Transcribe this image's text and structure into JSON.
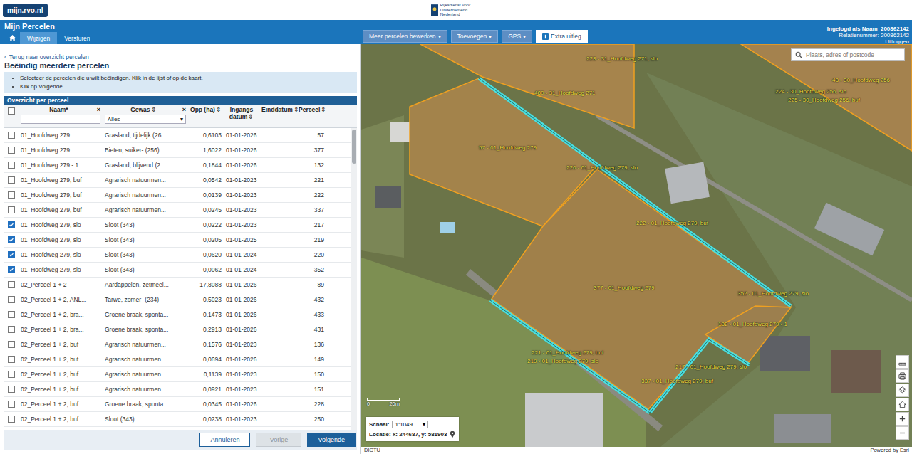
{
  "header": {
    "site_badge": "mijn.rvo.nl",
    "org": "Rijksdienst voor Ondernemend Nederland",
    "app_title": "Mijn Percelen",
    "user": "Ingelogd als Naam_200862142",
    "relation": "Relatienummer: 200862142",
    "logout": "Uitloggen"
  },
  "tabs": [
    {
      "label": "Wijzigen",
      "selected": true
    },
    {
      "label": "Versturen",
      "selected": false
    }
  ],
  "toolbar": [
    {
      "label": "Meer percelen bewerken",
      "caret": "▾",
      "primary": false
    },
    {
      "label": "Toevoegen",
      "caret": "▾",
      "primary": false
    },
    {
      "label": "GPS",
      "caret": "▾",
      "primary": false
    },
    {
      "label": "Extra uitleg",
      "caret": "",
      "primary": true
    }
  ],
  "panel": {
    "back_icon": "‹",
    "back": "Terug naar overzicht percelen",
    "title": "Beëindig meerdere percelen",
    "instructions": [
      "Selecteer de percelen die u wilt beëindigen. Klik in de lijst of op de kaart.",
      "Klik op Volgende."
    ],
    "table_title": "Overzicht per perceel"
  },
  "table": {
    "all_checked": false,
    "name_filter": "",
    "crop_filter": "Alles",
    "crop_filter_caret": "▾",
    "columns": [
      {
        "label": "Naam*",
        "sort": "",
        "clear": "×"
      },
      {
        "label": "Gewas",
        "sort": "⇕",
        "clear": "×"
      },
      {
        "label": "Opp (ha)",
        "sort": "⇕",
        "clear": ""
      },
      {
        "label": "Ingangs datum",
        "sort": "⇕",
        "clear": ""
      },
      {
        "label": "Einddatum",
        "sort": "⇕",
        "clear": ""
      },
      {
        "label": "Perceel",
        "sort": "⇕",
        "clear": ""
      }
    ],
    "rows": [
      {
        "checked": false,
        "name": "01_Hoofdweg 279",
        "crop": "Grasland, tijdelijk (26...",
        "area": "0,6103",
        "start": "01-01-2026",
        "end": "",
        "parcel": "57"
      },
      {
        "checked": false,
        "name": "01_Hoofdweg 279",
        "crop": "Bieten, suiker- (256)",
        "area": "1,6022",
        "start": "01-01-2026",
        "end": "",
        "parcel": "377"
      },
      {
        "checked": false,
        "name": "01_Hoofdweg 279 - 1",
        "crop": "Grasland, blijvend (2...",
        "area": "0,1844",
        "start": "01-01-2026",
        "end": "",
        "parcel": "132"
      },
      {
        "checked": false,
        "name": "01_Hoofdweg 279, buf",
        "crop": "Agrarisch natuurmen...",
        "area": "0,0542",
        "start": "01-01-2023",
        "end": "",
        "parcel": "221"
      },
      {
        "checked": false,
        "name": "01_Hoofdweg 279, buf",
        "crop": "Agrarisch natuurmen...",
        "area": "0,0139",
        "start": "01-01-2023",
        "end": "",
        "parcel": "222"
      },
      {
        "checked": false,
        "name": "01_Hoofdweg 279, buf",
        "crop": "Agrarisch natuurmen...",
        "area": "0,0245",
        "start": "01-01-2023",
        "end": "",
        "parcel": "337"
      },
      {
        "checked": true,
        "name": "01_Hoofdweg 279, slo",
        "crop": "Sloot (343)",
        "area": "0,0222",
        "start": "01-01-2023",
        "end": "",
        "parcel": "217"
      },
      {
        "checked": true,
        "name": "01_Hoofdweg 279, slo",
        "crop": "Sloot (343)",
        "area": "0,0205",
        "start": "01-01-2025",
        "end": "",
        "parcel": "219"
      },
      {
        "checked": true,
        "name": "01_Hoofdweg 279, slo",
        "crop": "Sloot (343)",
        "area": "0,0620",
        "start": "01-01-2024",
        "end": "",
        "parcel": "220"
      },
      {
        "checked": true,
        "name": "01_Hoofdweg 279, slo",
        "crop": "Sloot (343)",
        "area": "0,0062",
        "start": "01-01-2024",
        "end": "",
        "parcel": "352"
      },
      {
        "checked": false,
        "name": "02_Perceel 1 + 2",
        "crop": "Aardappelen, zetmeel...",
        "area": "17,8088",
        "start": "01-01-2026",
        "end": "",
        "parcel": "89"
      },
      {
        "checked": false,
        "name": "02_Perceel 1 + 2, ANL...",
        "crop": "Tarwe, zomer- (234)",
        "area": "0,5023",
        "start": "01-01-2026",
        "end": "",
        "parcel": "432"
      },
      {
        "checked": false,
        "name": "02_Perceel 1 + 2, bra...",
        "crop": "Groene braak, sponta...",
        "area": "0,1473",
        "start": "01-01-2026",
        "end": "",
        "parcel": "433"
      },
      {
        "checked": false,
        "name": "02_Perceel 1 + 2, bra...",
        "crop": "Groene braak, sponta...",
        "area": "0,2913",
        "start": "01-01-2026",
        "end": "",
        "parcel": "431"
      },
      {
        "checked": false,
        "name": "02_Perceel 1 + 2, buf",
        "crop": "Agrarisch natuurmen...",
        "area": "0,1576",
        "start": "01-01-2023",
        "end": "",
        "parcel": "136"
      },
      {
        "checked": false,
        "name": "02_Perceel 1 + 2, buf",
        "crop": "Agrarisch natuurmen...",
        "area": "0,0694",
        "start": "01-01-2026",
        "end": "",
        "parcel": "149"
      },
      {
        "checked": false,
        "name": "02_Perceel 1 + 2, buf",
        "crop": "Agrarisch natuurmen...",
        "area": "0,1139",
        "start": "01-01-2023",
        "end": "",
        "parcel": "150"
      },
      {
        "checked": false,
        "name": "02_Perceel 1 + 2, buf",
        "crop": "Agrarisch natuurmen...",
        "area": "0,0921",
        "start": "01-01-2023",
        "end": "",
        "parcel": "151"
      },
      {
        "checked": false,
        "name": "02_Perceel 1 + 2, buf",
        "crop": "Groene braak, sponta...",
        "area": "0,0345",
        "start": "01-01-2026",
        "end": "",
        "parcel": "228"
      },
      {
        "checked": false,
        "name": "02_Perceel 1 + 2, buf",
        "crop": "Sloot (343)",
        "area": "0,0238",
        "start": "01-01-2023",
        "end": "",
        "parcel": "250"
      }
    ]
  },
  "footer_buttons": [
    {
      "label": "Annuleren",
      "kind": "secondary",
      "disabled": false
    },
    {
      "label": "Vorige",
      "kind": "secondary",
      "disabled": true
    },
    {
      "label": "Volgende",
      "kind": "primary",
      "disabled": false
    }
  ],
  "map": {
    "search_placeholder": "Plaats, adres of postcode",
    "scale_label": "Schaal:",
    "scale": "1:1049",
    "scale_caret": "▾",
    "location": "Locatie: x: 244687, y: 581903",
    "scalebar": [
      "0",
      "20m"
    ],
    "labels": [
      "223 - 31_Hoofdweg 271, slo",
      "480 - 31_Hoofdweg 271",
      "43 - 30_Hoofdweg 256",
      "224 - 30_Hoofdweg 256, slo",
      "225 - 30_Hoofdweg 256, buf",
      "57 - 01_Hoofdweg 279",
      "220 - 01_Hoofdweg 279, slo",
      "222 - 01_Hoofdweg 279, buf",
      "377 - 01_Hoofdweg 279",
      "352 - 01_Hoofdweg 279, slo",
      "132 - 01_Hoofdweg 279 - 1",
      "221 - 01_Hoofdweg 279, buf",
      "219 - 01_Hoofdweg 279, slo",
      "217 - 01_Hoofdweg 279, slo",
      "337 - 01_Hoofdweg 279, buf"
    ],
    "credit_left": "DICTU",
    "credit_right": "Powered by Esri"
  }
}
